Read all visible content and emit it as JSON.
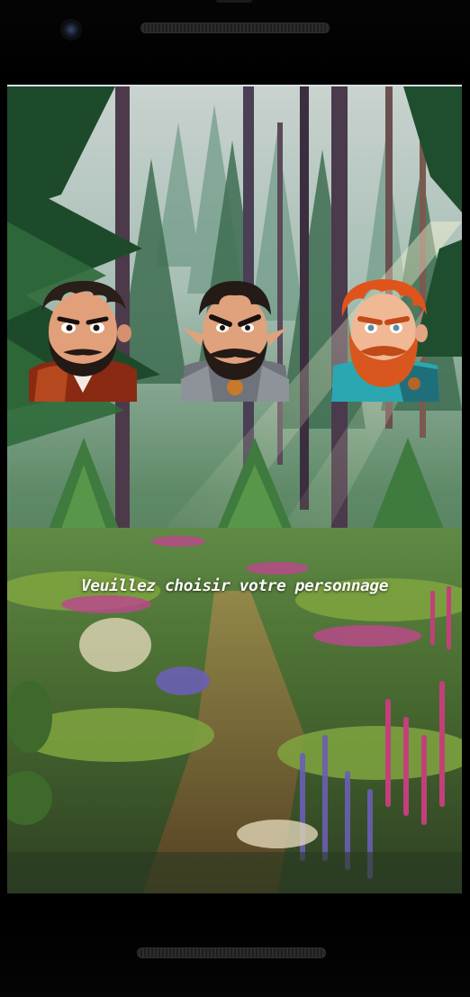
{
  "screen": {
    "prompt": "Veuillez choisir votre personnage"
  },
  "characters": [
    {
      "id": "human-rogue",
      "hair": "#2a1e18",
      "skin": "#e2a07a",
      "beard": "#231915",
      "outfit": "#8a2a12",
      "accent": "#f0ece4"
    },
    {
      "id": "elf-knight",
      "hair": "#241a16",
      "skin": "#e0a27c",
      "beard": "#241a16",
      "outfit": "#6f737b",
      "accent": "#c77a2a"
    },
    {
      "id": "dwarf-ginger",
      "hair": "#e0541c",
      "skin": "#f0b895",
      "beard": "#d8571e",
      "outfit": "#2aa7b0",
      "accent": "#b5652a"
    }
  ],
  "icons": {
    "front_camera": "camera-icon",
    "earpiece": "speaker-grill",
    "bottom_speaker": "speaker-grill"
  }
}
